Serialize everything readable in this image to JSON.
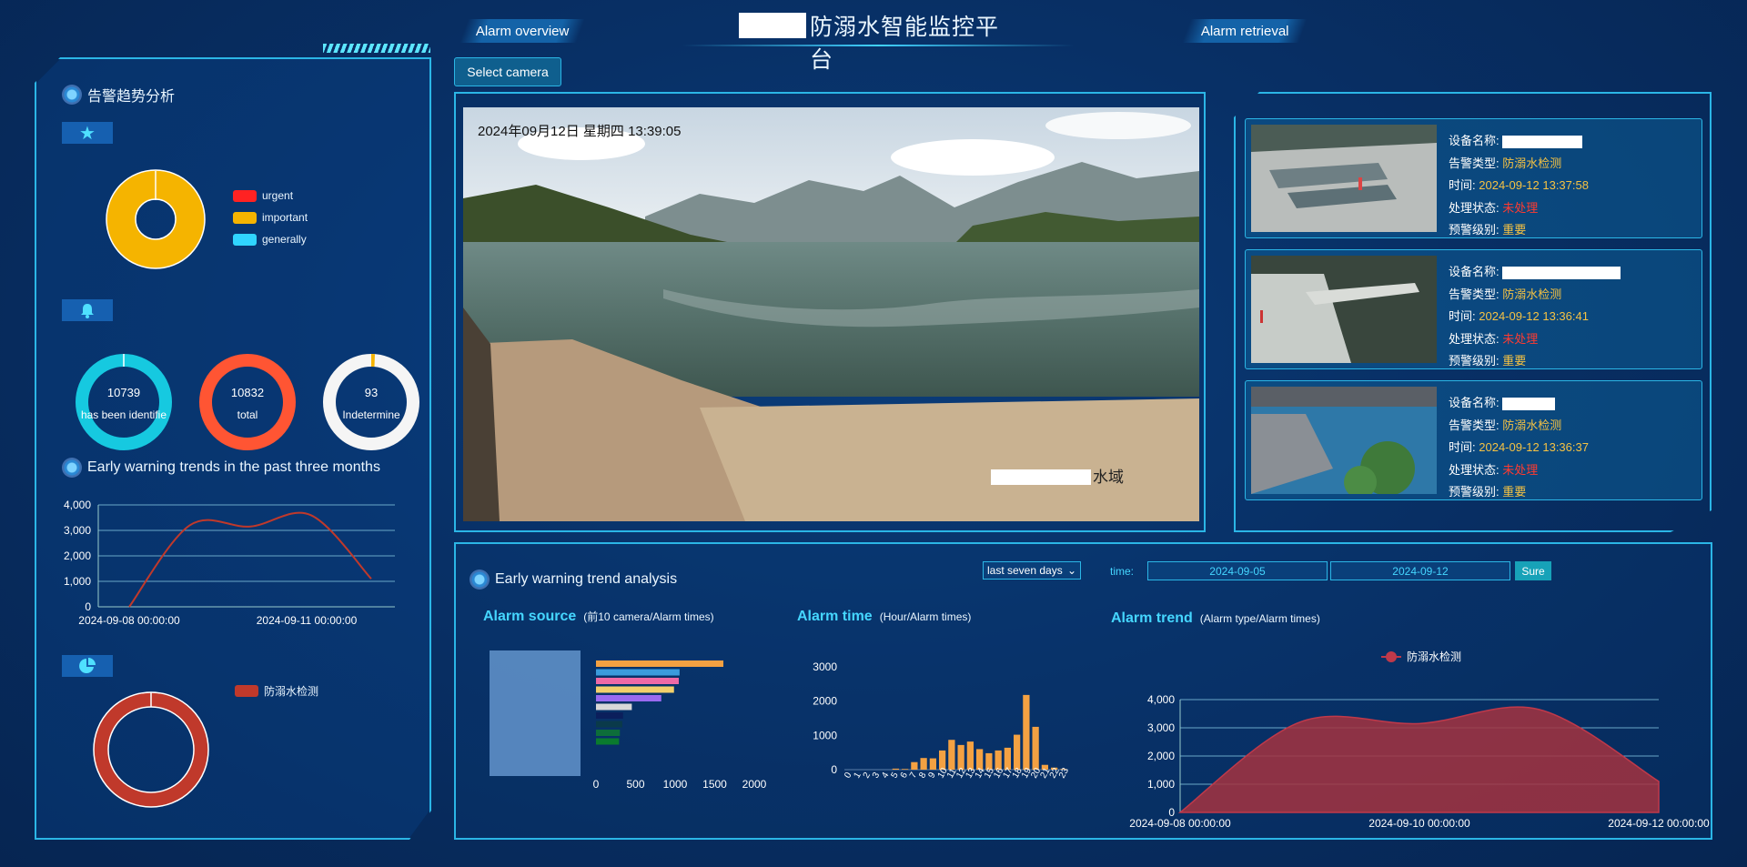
{
  "header": {
    "title": "防溺水智能监控平台",
    "left_tab": "Alarm overview",
    "right_tab": "Alarm retrieval"
  },
  "left": {
    "section1_title": "告警趋势分析",
    "legend": [
      {
        "label": "urgent",
        "color": "#ff2222"
      },
      {
        "label": "important",
        "color": "#f5b400"
      },
      {
        "label": "generally",
        "color": "#30d5ff"
      }
    ],
    "rings": [
      {
        "value": "10739",
        "label": "has been identifie",
        "color": "#16c9e0"
      },
      {
        "value": "10832",
        "label": "total",
        "color": "#ff5533"
      },
      {
        "value": "93",
        "label": "Indetermine",
        "color": "#f5f5f5"
      }
    ],
    "trend_title": "Early warning trends in the past three months",
    "trend_chart": {
      "y_ticks": [
        "4,000",
        "3,000",
        "2,000",
        "1,000",
        "0"
      ],
      "x_labels": [
        "2024-09-08 00:00:00",
        "2024-09-11 00:00:00"
      ],
      "color": "#c0392b"
    },
    "bottom_legend": "防溺水检测"
  },
  "main": {
    "select_camera": "Select camera",
    "video_timestamp": "2024年09月12日  星期四  13:39:05",
    "video_location_suffix": "水域"
  },
  "alarms": [
    {
      "name_label": "设备名称:",
      "type_label": "告警类型:",
      "type": "防溺水检测",
      "time_label": "时间:",
      "time": "2024-09-12 13:37:58",
      "status_label": "处理状态:",
      "status": "未处理",
      "level_label": "预警级别:",
      "level": "重要"
    },
    {
      "name_label": "设备名称:",
      "type_label": "告警类型:",
      "type": "防溺水检测",
      "time_label": "时间:",
      "time": "2024-09-12 13:36:41",
      "status_label": "处理状态:",
      "status": "未处理",
      "level_label": "预警级别:",
      "level": "重要"
    },
    {
      "name_label": "设备名称:",
      "type_label": "告警类型:",
      "type": "防溺水检测",
      "time_label": "时间:",
      "time": "2024-09-12 13:36:37",
      "status_label": "处理状态:",
      "status": "未处理",
      "level_label": "预警级别:",
      "level": "重要"
    }
  ],
  "bottom": {
    "title": "Early warning trend analysis",
    "range_select": "last seven days",
    "time_label": "time:",
    "date_from": "2024-09-05",
    "date_to": "2024-09-12",
    "sure": "Sure",
    "source_title": "Alarm source",
    "source_note": "(前10 camera/Alarm times)",
    "time_chart_title": "Alarm time",
    "time_chart_note": "(Hour/Alarm times)",
    "trend_title": "Alarm trend",
    "trend_note": "(Alarm type/Alarm times)",
    "trend_legend": "防溺水检测"
  },
  "chart_data": [
    {
      "type": "pie",
      "title": "",
      "labels": [
        "urgent",
        "important",
        "generally"
      ],
      "values": [
        0,
        100,
        0
      ]
    },
    {
      "type": "line",
      "title": "Early warning trends in the past three months",
      "x": [
        "2024-09-08",
        "2024-09-09",
        "2024-09-10",
        "2024-09-11",
        "2024-09-12"
      ],
      "values": [
        0,
        3200,
        3150,
        3600,
        1100
      ],
      "ylim": [
        0,
        4000
      ]
    },
    {
      "type": "pie",
      "title": "",
      "labels": [
        "防溺水检测"
      ],
      "values": [
        100
      ]
    },
    {
      "type": "bar",
      "title": "Alarm source",
      "orientation": "horizontal",
      "values": [
        1600,
        1050,
        1040,
        980,
        820,
        450,
        340,
        330,
        300,
        290
      ],
      "colors": [
        "#f4a142",
        "#3a9bdc",
        "#ef6aa6",
        "#f2d06b",
        "#9a6af0",
        "#d8d8d8",
        "#0b1f5c",
        "#0a3a4a",
        "#0d6d3a",
        "#0a7b2e"
      ],
      "xlim": [
        0,
        2000
      ],
      "x_ticks": [
        "0",
        "500",
        "1000",
        "1500",
        "2000"
      ]
    },
    {
      "type": "bar",
      "title": "Alarm time",
      "categories": [
        "0",
        "1",
        "2",
        "3",
        "4",
        "5",
        "6",
        "7",
        "8",
        "9",
        "10",
        "11",
        "12",
        "13",
        "14",
        "15",
        "16",
        "17",
        "18",
        "19",
        "20",
        "21",
        "22",
        "23"
      ],
      "values": [
        0,
        0,
        0,
        0,
        0,
        30,
        20,
        220,
        340,
        330,
        560,
        870,
        720,
        820,
        600,
        480,
        560,
        640,
        1020,
        2180,
        1250,
        140,
        60,
        20
      ],
      "ylim": [
        0,
        3000
      ],
      "y_ticks": [
        "0",
        "1000",
        "2000",
        "3000"
      ]
    },
    {
      "type": "area",
      "title": "Alarm trend",
      "series": [
        {
          "name": "防溺水检测",
          "values": [
            0,
            3200,
            3150,
            3650,
            1100
          ]
        }
      ],
      "x": [
        "2024-09-08",
        "2024-09-09",
        "2024-09-10",
        "2024-09-11",
        "2024-09-12"
      ],
      "x_labels": [
        "2024-09-08 00:00:00",
        "2024-09-10 00:00:00",
        "2024-09-12 00:00:00"
      ],
      "y_ticks": [
        "4,000",
        "3,000",
        "2,000",
        "1,000",
        "0"
      ],
      "ylim": [
        0,
        4000
      ]
    }
  ]
}
